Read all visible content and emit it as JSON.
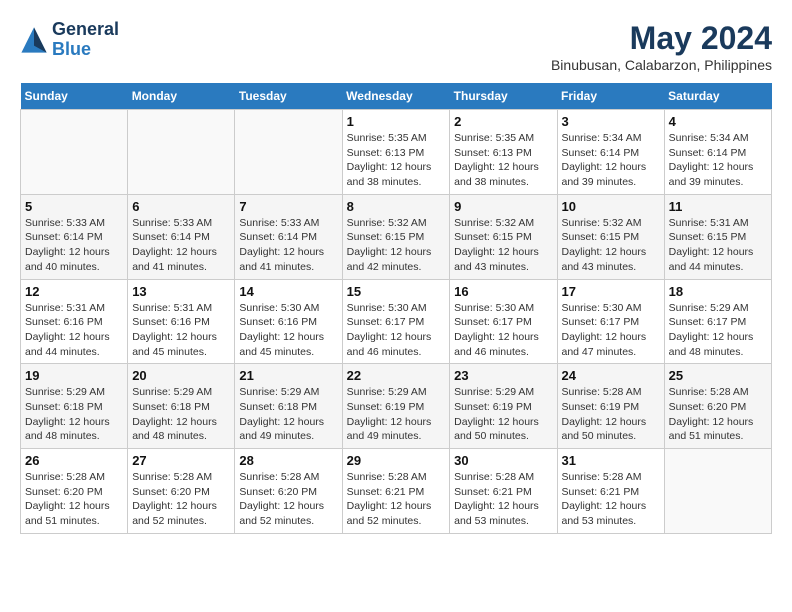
{
  "header": {
    "logo_line1": "General",
    "logo_line2": "Blue",
    "month": "May 2024",
    "location": "Binubusan, Calabarzon, Philippines"
  },
  "weekdays": [
    "Sunday",
    "Monday",
    "Tuesday",
    "Wednesday",
    "Thursday",
    "Friday",
    "Saturday"
  ],
  "weeks": [
    [
      {
        "day": "",
        "info": ""
      },
      {
        "day": "",
        "info": ""
      },
      {
        "day": "",
        "info": ""
      },
      {
        "day": "1",
        "info": "Sunrise: 5:35 AM\nSunset: 6:13 PM\nDaylight: 12 hours\nand 38 minutes."
      },
      {
        "day": "2",
        "info": "Sunrise: 5:35 AM\nSunset: 6:13 PM\nDaylight: 12 hours\nand 38 minutes."
      },
      {
        "day": "3",
        "info": "Sunrise: 5:34 AM\nSunset: 6:14 PM\nDaylight: 12 hours\nand 39 minutes."
      },
      {
        "day": "4",
        "info": "Sunrise: 5:34 AM\nSunset: 6:14 PM\nDaylight: 12 hours\nand 39 minutes."
      }
    ],
    [
      {
        "day": "5",
        "info": "Sunrise: 5:33 AM\nSunset: 6:14 PM\nDaylight: 12 hours\nand 40 minutes."
      },
      {
        "day": "6",
        "info": "Sunrise: 5:33 AM\nSunset: 6:14 PM\nDaylight: 12 hours\nand 41 minutes."
      },
      {
        "day": "7",
        "info": "Sunrise: 5:33 AM\nSunset: 6:14 PM\nDaylight: 12 hours\nand 41 minutes."
      },
      {
        "day": "8",
        "info": "Sunrise: 5:32 AM\nSunset: 6:15 PM\nDaylight: 12 hours\nand 42 minutes."
      },
      {
        "day": "9",
        "info": "Sunrise: 5:32 AM\nSunset: 6:15 PM\nDaylight: 12 hours\nand 43 minutes."
      },
      {
        "day": "10",
        "info": "Sunrise: 5:32 AM\nSunset: 6:15 PM\nDaylight: 12 hours\nand 43 minutes."
      },
      {
        "day": "11",
        "info": "Sunrise: 5:31 AM\nSunset: 6:15 PM\nDaylight: 12 hours\nand 44 minutes."
      }
    ],
    [
      {
        "day": "12",
        "info": "Sunrise: 5:31 AM\nSunset: 6:16 PM\nDaylight: 12 hours\nand 44 minutes."
      },
      {
        "day": "13",
        "info": "Sunrise: 5:31 AM\nSunset: 6:16 PM\nDaylight: 12 hours\nand 45 minutes."
      },
      {
        "day": "14",
        "info": "Sunrise: 5:30 AM\nSunset: 6:16 PM\nDaylight: 12 hours\nand 45 minutes."
      },
      {
        "day": "15",
        "info": "Sunrise: 5:30 AM\nSunset: 6:17 PM\nDaylight: 12 hours\nand 46 minutes."
      },
      {
        "day": "16",
        "info": "Sunrise: 5:30 AM\nSunset: 6:17 PM\nDaylight: 12 hours\nand 46 minutes."
      },
      {
        "day": "17",
        "info": "Sunrise: 5:30 AM\nSunset: 6:17 PM\nDaylight: 12 hours\nand 47 minutes."
      },
      {
        "day": "18",
        "info": "Sunrise: 5:29 AM\nSunset: 6:17 PM\nDaylight: 12 hours\nand 48 minutes."
      }
    ],
    [
      {
        "day": "19",
        "info": "Sunrise: 5:29 AM\nSunset: 6:18 PM\nDaylight: 12 hours\nand 48 minutes."
      },
      {
        "day": "20",
        "info": "Sunrise: 5:29 AM\nSunset: 6:18 PM\nDaylight: 12 hours\nand 48 minutes."
      },
      {
        "day": "21",
        "info": "Sunrise: 5:29 AM\nSunset: 6:18 PM\nDaylight: 12 hours\nand 49 minutes."
      },
      {
        "day": "22",
        "info": "Sunrise: 5:29 AM\nSunset: 6:19 PM\nDaylight: 12 hours\nand 49 minutes."
      },
      {
        "day": "23",
        "info": "Sunrise: 5:29 AM\nSunset: 6:19 PM\nDaylight: 12 hours\nand 50 minutes."
      },
      {
        "day": "24",
        "info": "Sunrise: 5:28 AM\nSunset: 6:19 PM\nDaylight: 12 hours\nand 50 minutes."
      },
      {
        "day": "25",
        "info": "Sunrise: 5:28 AM\nSunset: 6:20 PM\nDaylight: 12 hours\nand 51 minutes."
      }
    ],
    [
      {
        "day": "26",
        "info": "Sunrise: 5:28 AM\nSunset: 6:20 PM\nDaylight: 12 hours\nand 51 minutes."
      },
      {
        "day": "27",
        "info": "Sunrise: 5:28 AM\nSunset: 6:20 PM\nDaylight: 12 hours\nand 52 minutes."
      },
      {
        "day": "28",
        "info": "Sunrise: 5:28 AM\nSunset: 6:20 PM\nDaylight: 12 hours\nand 52 minutes."
      },
      {
        "day": "29",
        "info": "Sunrise: 5:28 AM\nSunset: 6:21 PM\nDaylight: 12 hours\nand 52 minutes."
      },
      {
        "day": "30",
        "info": "Sunrise: 5:28 AM\nSunset: 6:21 PM\nDaylight: 12 hours\nand 53 minutes."
      },
      {
        "day": "31",
        "info": "Sunrise: 5:28 AM\nSunset: 6:21 PM\nDaylight: 12 hours\nand 53 minutes."
      },
      {
        "day": "",
        "info": ""
      }
    ]
  ]
}
